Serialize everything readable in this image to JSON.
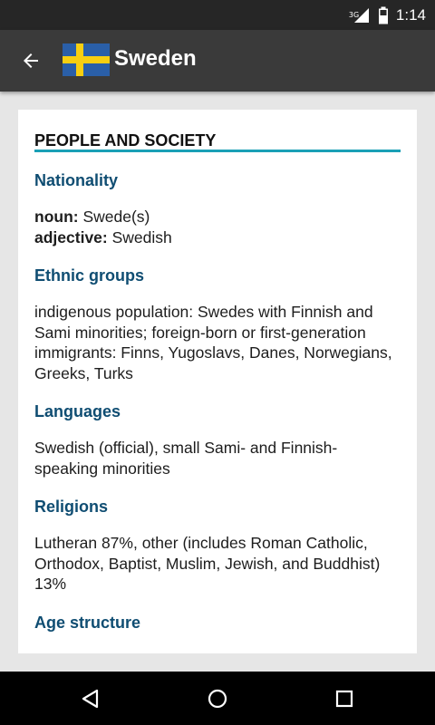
{
  "status_bar": {
    "network_label": "3G",
    "time": "1:14"
  },
  "app_bar": {
    "title": "Sweden",
    "back_icon": "arrow-back-icon",
    "flag_colors": {
      "blue": "#2a5fa8",
      "yellow": "#f7cf11"
    }
  },
  "section": {
    "title": "PEOPLE AND SOCIETY",
    "accent_color": "#1aa0b6",
    "label_color": "#0f4d72"
  },
  "fields": {
    "nationality": {
      "label": "Nationality",
      "noun_key": "noun:",
      "noun_value": " Swede(s)",
      "adjective_key": "adjective:",
      "adjective_value": " Swedish"
    },
    "ethnic_groups": {
      "label": "Ethnic groups",
      "value": "indigenous population: Swedes with Finnish and Sami minorities; foreign-born or first-generation immigrants: Finns, Yugoslavs, Danes, Norwegians, Greeks, Turks"
    },
    "languages": {
      "label": "Languages",
      "value": "Swedish (official), small Sami- and Finnish-speaking minorities"
    },
    "religions": {
      "label": "Religions",
      "value": "Lutheran 87%, other (includes Roman Catholic, Orthodox, Baptist, Muslim, Jewish, and Buddhist) 13%"
    },
    "age_structure": {
      "label": "Age structure"
    }
  },
  "nav_bar": {
    "back_icon": "triangle-back-icon",
    "home_icon": "circle-home-icon",
    "recents_icon": "square-recents-icon"
  }
}
